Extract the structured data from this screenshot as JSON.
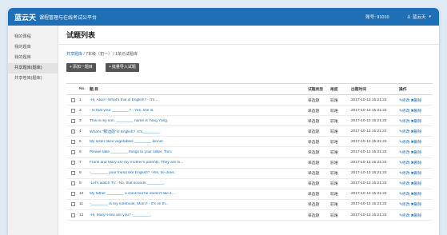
{
  "header": {
    "brand": "蓝云天",
    "subtitle": "课程管理与在线考试公平台",
    "account": "账号: 91010",
    "user": "蓝云天",
    "user_icon": "user-icon",
    "caret_icon": "caret-down-icon"
  },
  "sidebar": {
    "items": [
      {
        "label": "我的课程"
      },
      {
        "label": "我的题库"
      },
      {
        "label": "我的题库"
      },
      {
        "label": "共享题库(题库)"
      },
      {
        "label": "共享卷库(题库)"
      }
    ]
  },
  "main": {
    "title": "试题列表",
    "breadcrumb": {
      "root": "共享题库",
      "sep1": " / ",
      "level": "7年级（初一）",
      "sep2": " / ",
      "unit": "1单元试题库"
    },
    "buttons": {
      "add": "添加一题目",
      "batch_import": "批量导入试题"
    }
  },
  "table": {
    "headers": {
      "no": "No.",
      "title": "题 目",
      "type": "试题类型",
      "difficulty": "难度",
      "created": "出题时间",
      "ops": "操作"
    },
    "rows": [
      {
        "no": "1",
        "title": "-Hi, Alice ! What's this in English? - It's...",
        "type": "单选题",
        "difficulty": "较难",
        "created": "2017-10-13 15:21:23",
        "edit": "✎修改",
        "del": "✖删除"
      },
      {
        "no": "2",
        "title": "- Is that your ________? - Yes, she is.",
        "type": "单选题",
        "difficulty": "较难",
        "created": "2017-10-13 15:21:23",
        "edit": "✎修改",
        "del": "✖删除"
      },
      {
        "no": "3",
        "title": "This is my son. ________ name is Yang Yang.",
        "type": "单选题",
        "difficulty": "较难",
        "created": "2017-10-13 15:21:23",
        "edit": "✎修改",
        "del": "✖删除"
      },
      {
        "no": "4",
        "title": "What's \"那边的\"in English? -It's________.",
        "type": "单选题",
        "difficulty": "较难",
        "created": "2017-10-13 15:21:23",
        "edit": "✎修改",
        "del": "✖删除"
      },
      {
        "no": "5",
        "title": "My sister likes vegetables ________ dinner.",
        "type": "单选题",
        "difficulty": "较难",
        "created": "2017-10-13 15:21:23",
        "edit": "✎修改",
        "del": "✖删除"
      },
      {
        "no": "6",
        "title": "Please take ________ things to your sister, Tom.",
        "type": "单选题",
        "difficulty": "较难",
        "created": "2017-10-13 15:21:23",
        "edit": "✎修改",
        "del": "✖删除"
      },
      {
        "no": "7",
        "title": "Frank and Mary are my mother's parents. They are m...",
        "type": "单选题",
        "difficulty": "较难",
        "created": "2017-10-13 15:21:23",
        "edit": "✎修改",
        "del": "✖删除"
      },
      {
        "no": "8",
        "title": "-________ your friend like English? -Yes, he does.",
        "type": "单选题",
        "difficulty": "较难",
        "created": "2017-10-13 15:21:23",
        "edit": "✎修改",
        "del": "✖删除"
      },
      {
        "no": "9",
        "title": "-Let's watch TV. -No, that sounds ________.",
        "type": "单选题",
        "difficulty": "较难",
        "created": "2017-10-13 15:21:23",
        "edit": "✎修改",
        "del": "✖删除"
      },
      {
        "no": "10",
        "title": "My father ________ a clock but he doesn't like it....",
        "type": "单选题",
        "difficulty": "较难",
        "created": "2017-10-13 15:21:23",
        "edit": "✎修改",
        "del": "✖删除"
      },
      {
        "no": "11",
        "title": "-________ is my notebook, Mom? - It's on th...",
        "type": "单选题",
        "difficulty": "较难",
        "created": "2017-10-13 15:21:23",
        "edit": "✎修改",
        "del": "✖删除"
      },
      {
        "no": "12",
        "title": "-Hi, Mary! How are you? -________.",
        "type": "单选题",
        "difficulty": "较难",
        "created": "2017-10-13 15:21:23",
        "edit": "✎修改",
        "del": "✖删除"
      }
    ]
  },
  "colors": {
    "accent": "#1e6fb5",
    "background": "#dfeaf5",
    "button": "#555555"
  }
}
